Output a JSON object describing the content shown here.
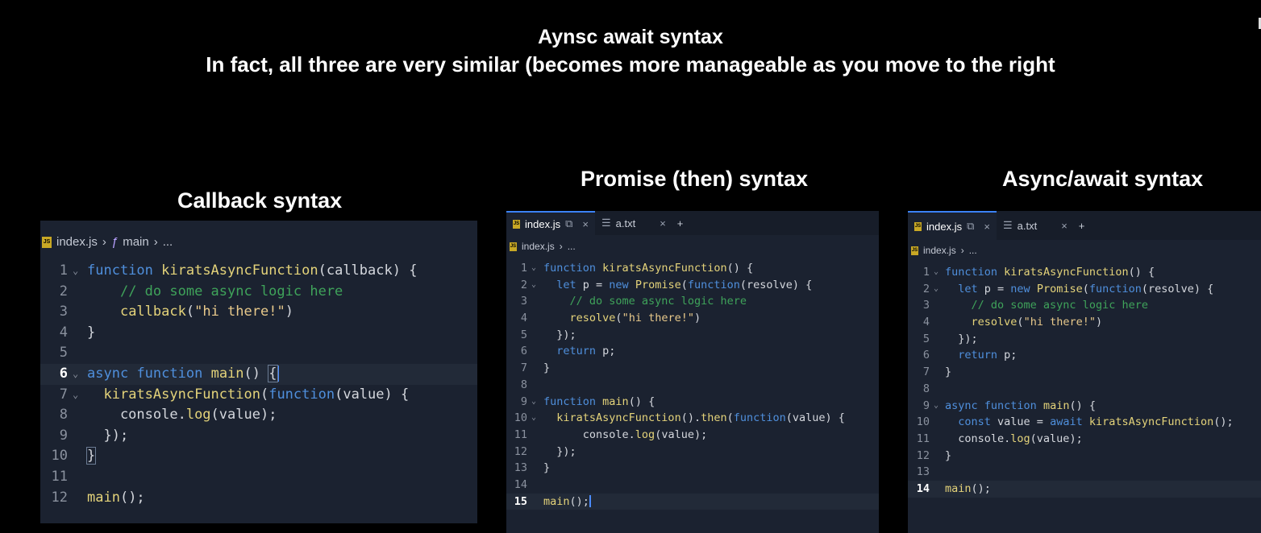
{
  "slide": {
    "title": "Aynsc await syntax",
    "subtitle": "In fact, all three are very similar (becomes more manageable as you move to the right"
  },
  "panels": [
    {
      "heading": "Callback syntax",
      "breadcrumb": {
        "file": "index.js",
        "func_icon": "ƒ",
        "func": "main",
        "more": "..."
      },
      "tabs": [],
      "current_line": 6
    },
    {
      "heading": "Promise (then) syntax",
      "breadcrumb": {
        "file": "index.js",
        "more": "..."
      },
      "tabs": [
        {
          "label": "index.js",
          "active": true,
          "close": "×"
        },
        {
          "label": "a.txt",
          "active": false,
          "close": "×"
        }
      ],
      "add_tab": "+",
      "current_line": 15
    },
    {
      "heading": "Async/await syntax",
      "breadcrumb": {
        "file": "index.js",
        "more": "..."
      },
      "tabs": [
        {
          "label": "index.js",
          "active": true,
          "close": "×"
        },
        {
          "label": "a.txt",
          "active": false,
          "close": "×"
        }
      ],
      "add_tab": "+",
      "current_line": 14
    }
  ],
  "icons": {
    "js_file": "js-file-icon",
    "fold": "chevron-down-icon",
    "split": "split-editor-icon",
    "text_file": "text-file-icon",
    "function": "function-icon"
  },
  "colors": {
    "keyword": "#4f8fdc",
    "function": "#e4d37a",
    "string": "#e8c98b",
    "comment": "#3fa35a",
    "editor_bg": "#1b2230"
  }
}
